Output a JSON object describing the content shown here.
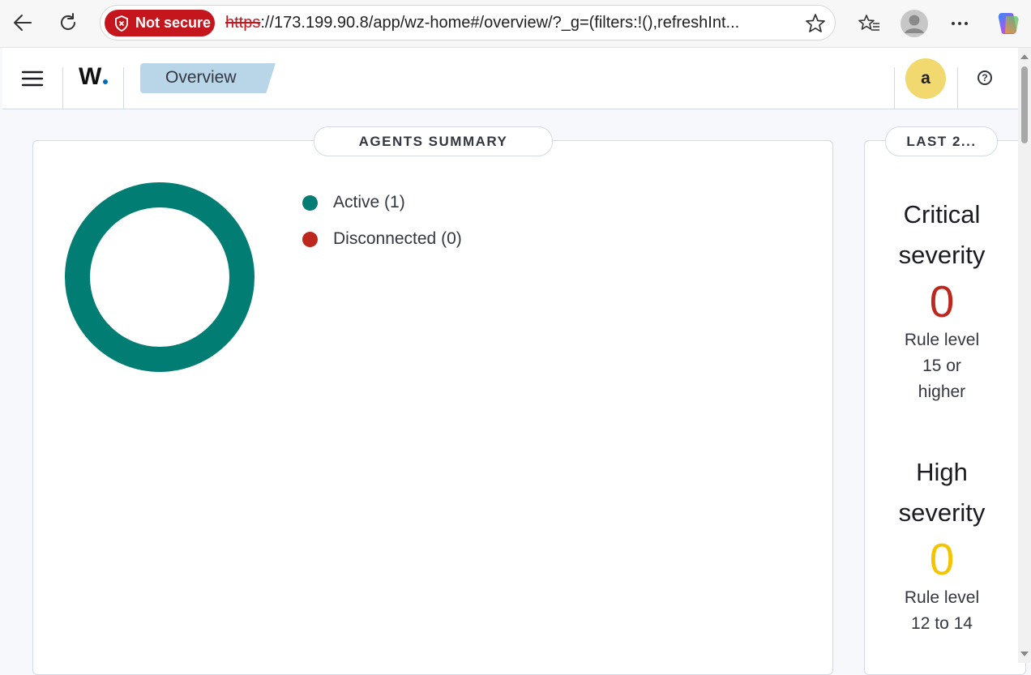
{
  "browser": {
    "security_label": "Not secure",
    "url_scheme": "https",
    "url_rest": "://173.199.90.8/app/wz-home#/overview/?_g=(filters:!(),refreshInt..."
  },
  "header": {
    "logo_text": "W",
    "breadcrumb": "Overview",
    "avatar_initial": "a",
    "help_symbol": "?"
  },
  "agents_summary": {
    "title": "AGENTS SUMMARY",
    "legend": [
      {
        "label": "Active (1)",
        "color": "#017d73"
      },
      {
        "label": "Disconnected (0)",
        "color": "#bd271e"
      }
    ],
    "chart_data": {
      "type": "pie",
      "categories": [
        "Active",
        "Disconnected"
      ],
      "values": [
        1,
        0
      ],
      "colors": [
        "#017d73",
        "#bd271e"
      ]
    }
  },
  "last_alerts": {
    "title": "LAST 2...",
    "items": [
      {
        "title_line1": "Critical",
        "title_line2": "severity",
        "count": "0",
        "color": "#bd271e",
        "desc_line1": "Rule level",
        "desc_line2": "15 or",
        "desc_line3": "higher"
      },
      {
        "title_line1": "High",
        "title_line2": "severity",
        "count": "0",
        "color": "#f5c400",
        "desc_line1": "Rule level",
        "desc_line2": "12 to 14",
        "desc_line3": ""
      }
    ]
  }
}
